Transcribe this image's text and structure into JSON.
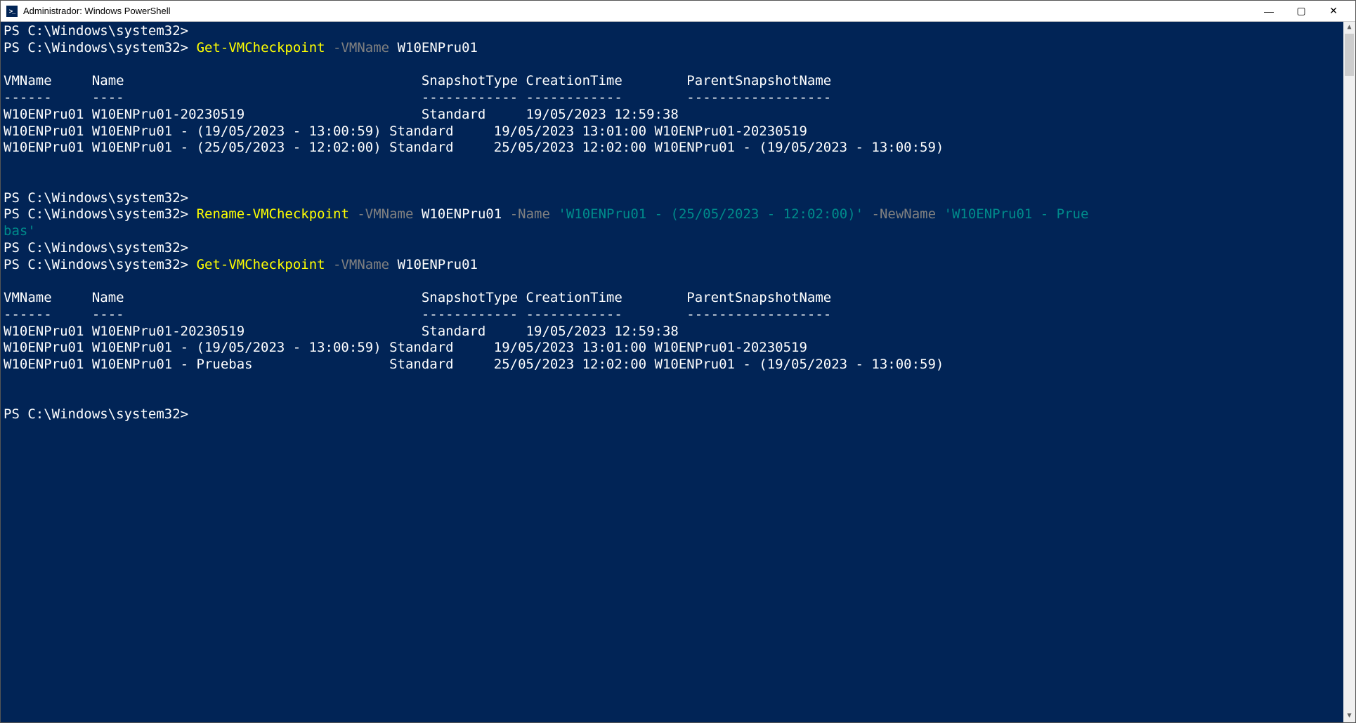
{
  "window": {
    "title": "Administrador: Windows PowerShell"
  },
  "colors": {
    "background": "#012456",
    "foreground": "#ffffff",
    "cmdlet": "#ffff00",
    "parameter": "#808080",
    "string": "#008b8b"
  },
  "prompt": "PS C:\\Windows\\system32>",
  "commands": {
    "c1": {
      "cmdlet": "Get-VMCheckpoint",
      "p1": "-VMName",
      "a1": "W10ENPru01"
    },
    "c2": {
      "cmdlet": "Rename-VMCheckpoint",
      "p1": "-VMName",
      "a1": "W10ENPru01",
      "p2": "-Name",
      "s1": "'W10ENPru01 - (25/05/2023 - 12:02:00)'",
      "p3": "-NewName",
      "s2a": "'W10ENPru01 - Prue",
      "s2b": "bas'"
    },
    "c3": {
      "cmdlet": "Get-VMCheckpoint",
      "p1": "-VMName",
      "a1": "W10ENPru01"
    }
  },
  "output1": {
    "hdr": "VMName     Name                                     SnapshotType CreationTime        ParentSnapshotName",
    "sep": "------     ----                                     ------------ ------------        ------------------",
    "r1": "W10ENPru01 W10ENPru01-20230519                      Standard     19/05/2023 12:59:38",
    "r2": "W10ENPru01 W10ENPru01 - (19/05/2023 - 13:00:59) Standard     19/05/2023 13:01:00 W10ENPru01-20230519",
    "r3": "W10ENPru01 W10ENPru01 - (25/05/2023 - 12:02:00) Standard     25/05/2023 12:02:00 W10ENPru01 - (19/05/2023 - 13:00:59)"
  },
  "output2": {
    "hdr": "VMName     Name                                     SnapshotType CreationTime        ParentSnapshotName",
    "sep": "------     ----                                     ------------ ------------        ------------------",
    "r1": "W10ENPru01 W10ENPru01-20230519                      Standard     19/05/2023 12:59:38",
    "r2": "W10ENPru01 W10ENPru01 - (19/05/2023 - 13:00:59) Standard     19/05/2023 13:01:00 W10ENPru01-20230519",
    "r3": "W10ENPru01 W10ENPru01 - Pruebas                 Standard     25/05/2023 12:02:00 W10ENPru01 - (19/05/2023 - 13:00:59)"
  }
}
